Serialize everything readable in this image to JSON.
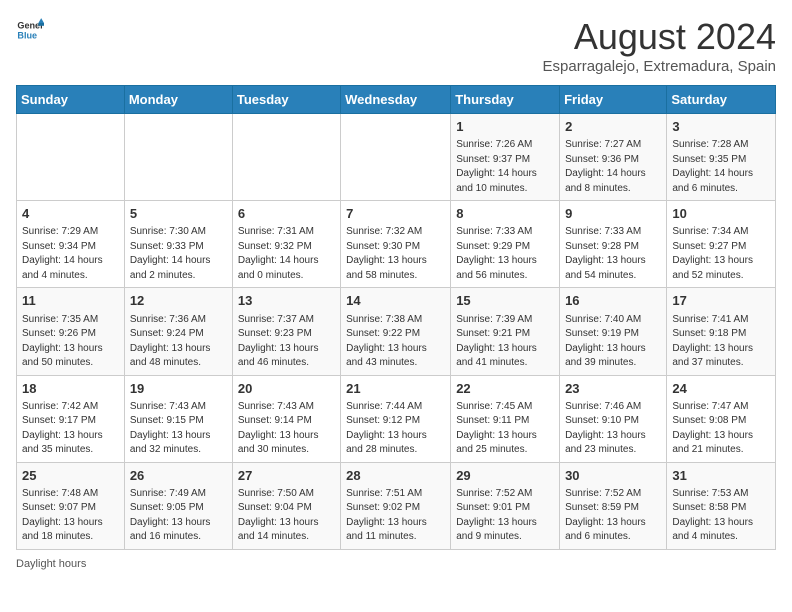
{
  "logo": {
    "line1": "General",
    "line2": "Blue"
  },
  "title": "August 2024",
  "subtitle": "Esparragalejo, Extremadura, Spain",
  "days_of_week": [
    "Sunday",
    "Monday",
    "Tuesday",
    "Wednesday",
    "Thursday",
    "Friday",
    "Saturday"
  ],
  "weeks": [
    [
      {
        "day": "",
        "content": ""
      },
      {
        "day": "",
        "content": ""
      },
      {
        "day": "",
        "content": ""
      },
      {
        "day": "",
        "content": ""
      },
      {
        "day": "1",
        "content": "Sunrise: 7:26 AM\nSunset: 9:37 PM\nDaylight: 14 hours and 10 minutes."
      },
      {
        "day": "2",
        "content": "Sunrise: 7:27 AM\nSunset: 9:36 PM\nDaylight: 14 hours and 8 minutes."
      },
      {
        "day": "3",
        "content": "Sunrise: 7:28 AM\nSunset: 9:35 PM\nDaylight: 14 hours and 6 minutes."
      }
    ],
    [
      {
        "day": "4",
        "content": "Sunrise: 7:29 AM\nSunset: 9:34 PM\nDaylight: 14 hours and 4 minutes."
      },
      {
        "day": "5",
        "content": "Sunrise: 7:30 AM\nSunset: 9:33 PM\nDaylight: 14 hours and 2 minutes."
      },
      {
        "day": "6",
        "content": "Sunrise: 7:31 AM\nSunset: 9:32 PM\nDaylight: 14 hours and 0 minutes."
      },
      {
        "day": "7",
        "content": "Sunrise: 7:32 AM\nSunset: 9:30 PM\nDaylight: 13 hours and 58 minutes."
      },
      {
        "day": "8",
        "content": "Sunrise: 7:33 AM\nSunset: 9:29 PM\nDaylight: 13 hours and 56 minutes."
      },
      {
        "day": "9",
        "content": "Sunrise: 7:33 AM\nSunset: 9:28 PM\nDaylight: 13 hours and 54 minutes."
      },
      {
        "day": "10",
        "content": "Sunrise: 7:34 AM\nSunset: 9:27 PM\nDaylight: 13 hours and 52 minutes."
      }
    ],
    [
      {
        "day": "11",
        "content": "Sunrise: 7:35 AM\nSunset: 9:26 PM\nDaylight: 13 hours and 50 minutes."
      },
      {
        "day": "12",
        "content": "Sunrise: 7:36 AM\nSunset: 9:24 PM\nDaylight: 13 hours and 48 minutes."
      },
      {
        "day": "13",
        "content": "Sunrise: 7:37 AM\nSunset: 9:23 PM\nDaylight: 13 hours and 46 minutes."
      },
      {
        "day": "14",
        "content": "Sunrise: 7:38 AM\nSunset: 9:22 PM\nDaylight: 13 hours and 43 minutes."
      },
      {
        "day": "15",
        "content": "Sunrise: 7:39 AM\nSunset: 9:21 PM\nDaylight: 13 hours and 41 minutes."
      },
      {
        "day": "16",
        "content": "Sunrise: 7:40 AM\nSunset: 9:19 PM\nDaylight: 13 hours and 39 minutes."
      },
      {
        "day": "17",
        "content": "Sunrise: 7:41 AM\nSunset: 9:18 PM\nDaylight: 13 hours and 37 minutes."
      }
    ],
    [
      {
        "day": "18",
        "content": "Sunrise: 7:42 AM\nSunset: 9:17 PM\nDaylight: 13 hours and 35 minutes."
      },
      {
        "day": "19",
        "content": "Sunrise: 7:43 AM\nSunset: 9:15 PM\nDaylight: 13 hours and 32 minutes."
      },
      {
        "day": "20",
        "content": "Sunrise: 7:43 AM\nSunset: 9:14 PM\nDaylight: 13 hours and 30 minutes."
      },
      {
        "day": "21",
        "content": "Sunrise: 7:44 AM\nSunset: 9:12 PM\nDaylight: 13 hours and 28 minutes."
      },
      {
        "day": "22",
        "content": "Sunrise: 7:45 AM\nSunset: 9:11 PM\nDaylight: 13 hours and 25 minutes."
      },
      {
        "day": "23",
        "content": "Sunrise: 7:46 AM\nSunset: 9:10 PM\nDaylight: 13 hours and 23 minutes."
      },
      {
        "day": "24",
        "content": "Sunrise: 7:47 AM\nSunset: 9:08 PM\nDaylight: 13 hours and 21 minutes."
      }
    ],
    [
      {
        "day": "25",
        "content": "Sunrise: 7:48 AM\nSunset: 9:07 PM\nDaylight: 13 hours and 18 minutes."
      },
      {
        "day": "26",
        "content": "Sunrise: 7:49 AM\nSunset: 9:05 PM\nDaylight: 13 hours and 16 minutes."
      },
      {
        "day": "27",
        "content": "Sunrise: 7:50 AM\nSunset: 9:04 PM\nDaylight: 13 hours and 14 minutes."
      },
      {
        "day": "28",
        "content": "Sunrise: 7:51 AM\nSunset: 9:02 PM\nDaylight: 13 hours and 11 minutes."
      },
      {
        "day": "29",
        "content": "Sunrise: 7:52 AM\nSunset: 9:01 PM\nDaylight: 13 hours and 9 minutes."
      },
      {
        "day": "30",
        "content": "Sunrise: 7:52 AM\nSunset: 8:59 PM\nDaylight: 13 hours and 6 minutes."
      },
      {
        "day": "31",
        "content": "Sunrise: 7:53 AM\nSunset: 8:58 PM\nDaylight: 13 hours and 4 minutes."
      }
    ]
  ],
  "footer": "Daylight hours"
}
